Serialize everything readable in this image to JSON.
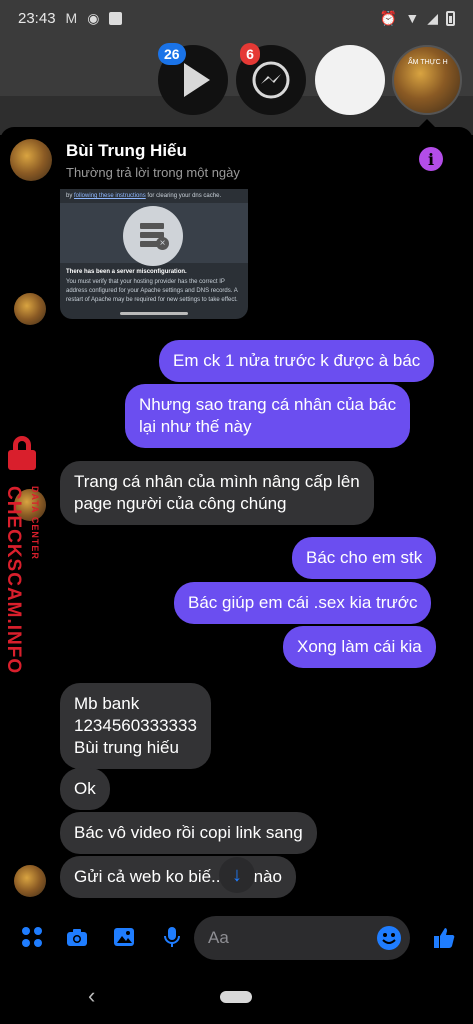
{
  "status_bar": {
    "time": "23:43",
    "left_icons": [
      "gmail-icon",
      "messenger-icon",
      "notification-square-icon"
    ],
    "right_icons": [
      "alarm-icon",
      "wifi-icon",
      "signal-icon",
      "battery-icon"
    ]
  },
  "chat_heads": [
    {
      "name": "play-chat-head",
      "badge": "26"
    },
    {
      "name": "messenger-chat-head",
      "badge": "6"
    },
    {
      "name": "blank-chat-head",
      "badge": ""
    },
    {
      "name": "contact-chat-head",
      "badge": "",
      "avatar_text": "ẨM THỰC H"
    }
  ],
  "header": {
    "name": "Bùi Trung Hiếu",
    "status": "Thường trả lời trong một ngày",
    "info_glyph": "i"
  },
  "image_message": {
    "top_text_prefix": "by ",
    "top_text_link": "following these instructions",
    "top_text_suffix": " for clearing your dns cache.",
    "title": "There has been a server misconfiguration.",
    "body": "You must verify that your hosting provider has the correct IP address configured for your Apache settings and DNS records. A restart of Apache may be required for new settings to take effect."
  },
  "messages": [
    {
      "dir": "out",
      "text": "Em ck 1 nửa trước k được à bác"
    },
    {
      "dir": "out",
      "lines": [
        "Nhưng sao trang cá nhân của bác",
        "lại như thế này"
      ]
    },
    {
      "dir": "in",
      "lines": [
        "Trang cá nhân của mình nâng cấp lên",
        "page người của công chúng"
      ]
    },
    {
      "dir": "out",
      "text": "Bác cho em stk"
    },
    {
      "dir": "out",
      "text": "Bác giúp em cái .sex kia trước"
    },
    {
      "dir": "out",
      "text": "Xong làm cái kia"
    },
    {
      "dir": "in",
      "lines": [
        "Mb bank",
        "1234560333333",
        "Bùi trung hiếu"
      ]
    },
    {
      "dir": "in",
      "text": "Ok"
    },
    {
      "dir": "in",
      "text": "Bác vô video rồi copi link sang"
    },
    {
      "dir": "in",
      "text": "Gửi cả web ko biế... eo nào"
    }
  ],
  "watermark": {
    "main": "CHECKSCAM.INFO",
    "sub": "DATA CENTER"
  },
  "composer": {
    "placeholder": "Aa",
    "icons": [
      "menu-dots-icon",
      "camera-icon",
      "gallery-icon",
      "microphone-icon",
      "emoji-icon",
      "thumbs-up-icon"
    ]
  },
  "scroll_down_glyph": "↓",
  "nav": {
    "back_glyph": "‹"
  },
  "colors": {
    "outgoing_bubble": "#6b4ef0",
    "incoming_bubble": "#333335",
    "accent_blue": "#1f7dff",
    "info_purple": "#b34de8",
    "watermark_red": "#d91f2c"
  }
}
